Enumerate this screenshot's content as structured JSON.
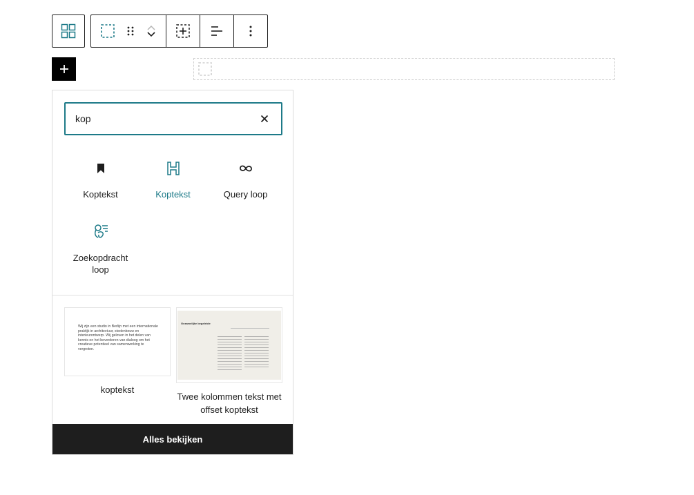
{
  "toolbar": {
    "icons": [
      "block-layout-icon",
      "group-select-icon",
      "drag-handle-icon",
      "move-up-icon",
      "move-down-icon",
      "block-frame-icon",
      "align-left-icon",
      "more-options-icon"
    ]
  },
  "inserter": {
    "search": {
      "value": "kop",
      "placeholder": ""
    },
    "blocks": [
      {
        "label": "Koptekst",
        "icon": "bookmark-icon",
        "color": "#1e1e1e"
      },
      {
        "label": "Koptekst",
        "icon": "heading-icon",
        "color": "#1d7a88"
      },
      {
        "label": "Query loop",
        "icon": "loop-icon",
        "color": "#1e1e1e"
      },
      {
        "label": "Zoekopdracht loop",
        "icon": "search-loop-icon",
        "color": "#1e1e1e"
      }
    ],
    "patterns": [
      {
        "label": "koptekst",
        "preview_text": "Wij zijn een studio in Berlijn met een internationale praktijk in architectuur, stedenbouw en interieurontwerp. Wij geloven in het delen van kennis en het bevorderen van dialoog om het creatieve potentieel van samenwerking te vergroten."
      },
      {
        "label": "Twee kolommen tekst met offset koptekst",
        "preview_title": "Gezamelijke begeleide"
      }
    ],
    "footer_label": "Alles bekijken"
  },
  "colors": {
    "accent": "#1d7a88",
    "dark": "#1e1e1e",
    "border": "#dcdcdc"
  }
}
